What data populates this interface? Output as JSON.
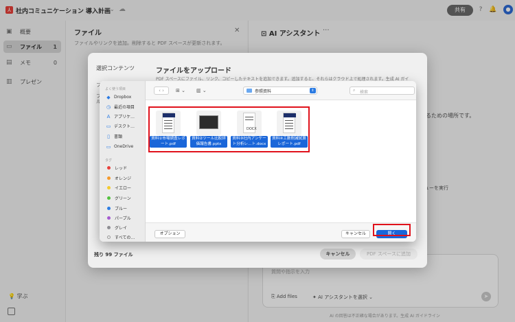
{
  "app": {
    "title": "社内コミュニケーション 導入計画",
    "share_label": "共有"
  },
  "sidebar": {
    "items": [
      {
        "label": "概要",
        "count": ""
      },
      {
        "label": "ファイル",
        "count": "1"
      },
      {
        "label": "メモ",
        "count": "0"
      },
      {
        "label": "プレゼン",
        "count": ""
      }
    ],
    "learn_label": "学ぶ"
  },
  "files_panel": {
    "title": "ファイル",
    "description": "ファイルやリンクを追加。削除すると PDF スペースが更新されます。"
  },
  "ai_panel": {
    "title": "AI アシスタント",
    "peek_text_1": "するための場所です。",
    "peek_text_2": "ューを実行",
    "prompt_placeholder": "質問や指示を入力",
    "add_files_label": "Add files",
    "select_assistant_label": "AI アシスタントを選択",
    "disclaimer": "AI の回答は不正確な場合があります。生成 AI ガイドライン"
  },
  "upload_dialog": {
    "left_title": "選択コンテンツ",
    "left_peek": [
      "フ",
      "フ",
      "ル"
    ],
    "title": "ファイルをアップロード",
    "description": "PDF スペースにファイル、リンク、コピーしたテキストを追加できます。追加すると、それらはクラウド上で処理されます。生成 AI ガイ",
    "remaining": "残り 99 ファイル",
    "cancel_label": "キャンセル",
    "add_label": "PDF スペースに追加"
  },
  "finder": {
    "favorites_header": "よく使う項目",
    "favorites": [
      {
        "icon": "dropbox-icon",
        "label": "Dropbox"
      },
      {
        "icon": "clock-icon",
        "label": "最近の項目"
      },
      {
        "icon": "apps-icon",
        "label": "アプリケ…"
      },
      {
        "icon": "desktop-icon",
        "label": "デスクト…"
      },
      {
        "icon": "document-icon",
        "label": "書類"
      },
      {
        "icon": "folder-icon",
        "label": "OneDrive"
      }
    ],
    "tags_header": "タグ",
    "tags": [
      {
        "label": "レッド",
        "color": "#e9413c"
      },
      {
        "label": "オレンジ",
        "color": "#f59a2c"
      },
      {
        "label": "イエロー",
        "color": "#f4cb2f"
      },
      {
        "label": "グリーン",
        "color": "#53c23f"
      },
      {
        "label": "ブルー",
        "color": "#2d7de3"
      },
      {
        "label": "パープル",
        "color": "#a55bd1"
      },
      {
        "label": "グレイ",
        "color": "#8e8e93"
      },
      {
        "label": "すべての…",
        "color": ""
      }
    ],
    "location": "参照資料",
    "search_placeholder": "検索",
    "files": [
      {
        "line1": "資料①市場調査レポ",
        "line2": "ート.pdf",
        "badge": ""
      },
      {
        "line1": "資料②ツール比較評",
        "line2": "価報告書.pptx",
        "badge": ""
      },
      {
        "line1": "資料③社内アンケー",
        "line2": "ト分析レ…ト.docx",
        "badge": "DOCX"
      },
      {
        "line1": "資料④工数削減試算",
        "line2": "レポート.pdf",
        "badge": ""
      }
    ],
    "options_label": "オプション",
    "cancel_label": "キャンセル",
    "open_label": "開く"
  }
}
